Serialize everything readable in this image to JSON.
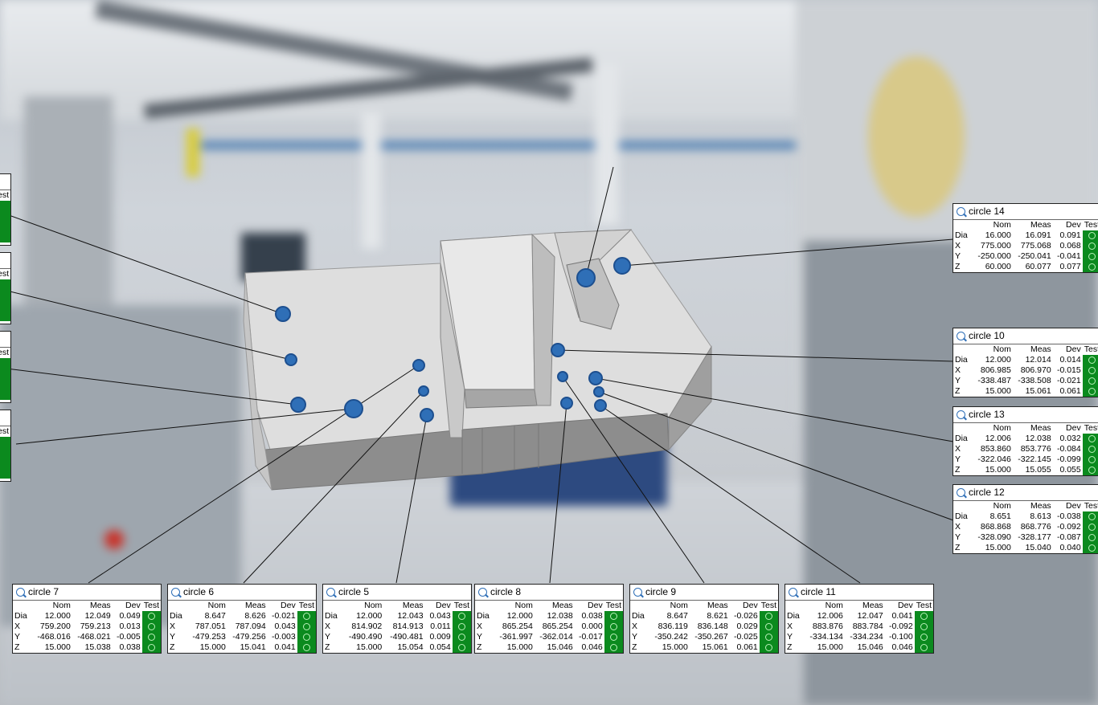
{
  "columns": [
    "Nom",
    "Meas",
    "Dev",
    "Test"
  ],
  "panels": {
    "c14": {
      "title": "circle 14",
      "rows": [
        {
          "lbl": "Dia",
          "nom": "16.000",
          "meas": "16.091",
          "dev": "0.091"
        },
        {
          "lbl": "X",
          "nom": "775.000",
          "meas": "775.068",
          "dev": "0.068"
        },
        {
          "lbl": "Y",
          "nom": "-250.000",
          "meas": "-250.041",
          "dev": "-0.041"
        },
        {
          "lbl": "Z",
          "nom": "60.000",
          "meas": "60.077",
          "dev": "0.077"
        }
      ]
    },
    "c10": {
      "title": "circle 10",
      "rows": [
        {
          "lbl": "Dia",
          "nom": "12.000",
          "meas": "12.014",
          "dev": "0.014"
        },
        {
          "lbl": "X",
          "nom": "806.985",
          "meas": "806.970",
          "dev": "-0.015"
        },
        {
          "lbl": "Y",
          "nom": "-338.487",
          "meas": "-338.508",
          "dev": "-0.021"
        },
        {
          "lbl": "Z",
          "nom": "15.000",
          "meas": "15.061",
          "dev": "0.061"
        }
      ]
    },
    "c13": {
      "title": "circle 13",
      "rows": [
        {
          "lbl": "Dia",
          "nom": "12.006",
          "meas": "12.038",
          "dev": "0.032"
        },
        {
          "lbl": "X",
          "nom": "853.860",
          "meas": "853.776",
          "dev": "-0.084"
        },
        {
          "lbl": "Y",
          "nom": "-322.046",
          "meas": "-322.145",
          "dev": "-0.099"
        },
        {
          "lbl": "Z",
          "nom": "15.000",
          "meas": "15.055",
          "dev": "0.055"
        }
      ]
    },
    "c12": {
      "title": "circle 12",
      "rows": [
        {
          "lbl": "Dia",
          "nom": "8.651",
          "meas": "8.613",
          "dev": "-0.038"
        },
        {
          "lbl": "X",
          "nom": "868.868",
          "meas": "868.776",
          "dev": "-0.092"
        },
        {
          "lbl": "Y",
          "nom": "-328.090",
          "meas": "-328.177",
          "dev": "-0.087"
        },
        {
          "lbl": "Z",
          "nom": "15.000",
          "meas": "15.040",
          "dev": "0.040"
        }
      ]
    },
    "c7": {
      "title": "circle 7",
      "rows": [
        {
          "lbl": "Dia",
          "nom": "12.000",
          "meas": "12.049",
          "dev": "0.049"
        },
        {
          "lbl": "X",
          "nom": "759.200",
          "meas": "759.213",
          "dev": "0.013"
        },
        {
          "lbl": "Y",
          "nom": "-468.016",
          "meas": "-468.021",
          "dev": "-0.005"
        },
        {
          "lbl": "Z",
          "nom": "15.000",
          "meas": "15.038",
          "dev": "0.038"
        }
      ]
    },
    "c6": {
      "title": "circle 6",
      "rows": [
        {
          "lbl": "Dia",
          "nom": "8.647",
          "meas": "8.626",
          "dev": "-0.021"
        },
        {
          "lbl": "X",
          "nom": "787.051",
          "meas": "787.094",
          "dev": "0.043"
        },
        {
          "lbl": "Y",
          "nom": "-479.253",
          "meas": "-479.256",
          "dev": "-0.003"
        },
        {
          "lbl": "Z",
          "nom": "15.000",
          "meas": "15.041",
          "dev": "0.041"
        }
      ]
    },
    "c5": {
      "title": "circle 5",
      "rows": [
        {
          "lbl": "Dia",
          "nom": "12.000",
          "meas": "12.043",
          "dev": "0.043"
        },
        {
          "lbl": "X",
          "nom": "814.902",
          "meas": "814.913",
          "dev": "0.011"
        },
        {
          "lbl": "Y",
          "nom": "-490.490",
          "meas": "-490.481",
          "dev": "0.009"
        },
        {
          "lbl": "Z",
          "nom": "15.000",
          "meas": "15.054",
          "dev": "0.054"
        }
      ]
    },
    "c8": {
      "title": "circle 8",
      "rows": [
        {
          "lbl": "Dia",
          "nom": "12.000",
          "meas": "12.038",
          "dev": "0.038"
        },
        {
          "lbl": "X",
          "nom": "865.254",
          "meas": "865.254",
          "dev": "0.000"
        },
        {
          "lbl": "Y",
          "nom": "-361.997",
          "meas": "-362.014",
          "dev": "-0.017"
        },
        {
          "lbl": "Z",
          "nom": "15.000",
          "meas": "15.046",
          "dev": "0.046"
        }
      ]
    },
    "c9": {
      "title": "circle 9",
      "rows": [
        {
          "lbl": "Dia",
          "nom": "8.647",
          "meas": "8.621",
          "dev": "-0.026"
        },
        {
          "lbl": "X",
          "nom": "836.119",
          "meas": "836.148",
          "dev": "0.029"
        },
        {
          "lbl": "Y",
          "nom": "-350.242",
          "meas": "-350.267",
          "dev": "-0.025"
        },
        {
          "lbl": "Z",
          "nom": "15.000",
          "meas": "15.061",
          "dev": "0.061"
        }
      ]
    },
    "c11": {
      "title": "circle 11",
      "rows": [
        {
          "lbl": "Dia",
          "nom": "12.006",
          "meas": "12.047",
          "dev": "0.041"
        },
        {
          "lbl": "X",
          "nom": "883.876",
          "meas": "883.784",
          "dev": "-0.092"
        },
        {
          "lbl": "Y",
          "nom": "-334.134",
          "meas": "-334.234",
          "dev": "-0.100"
        },
        {
          "lbl": "Z",
          "nom": "15.000",
          "meas": "15.046",
          "dev": "0.046"
        }
      ]
    },
    "left": {
      "header": "est"
    }
  },
  "colors": {
    "pass": "#0b8a1e",
    "hole": "#2f6fb7",
    "part": "#d9d9d9"
  },
  "icons": {
    "panel_icon": "inspection-icon",
    "test_icon": "pass-circle-icon"
  }
}
